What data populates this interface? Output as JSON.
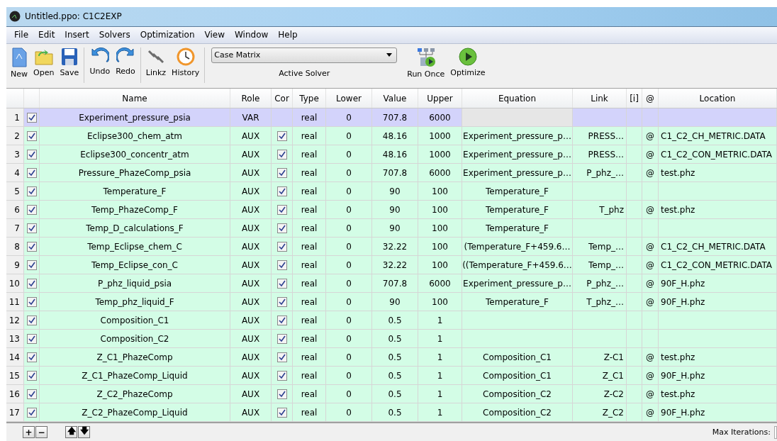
{
  "window": {
    "title": "Untitled.ppo: C1C2EXP"
  },
  "menu": [
    "File",
    "Edit",
    "Insert",
    "Solvers",
    "Optimization",
    "View",
    "Window",
    "Help"
  ],
  "toolbar": [
    {
      "kind": "new",
      "label": "New"
    },
    {
      "kind": "open",
      "label": "Open"
    },
    {
      "kind": "save",
      "label": "Save"
    },
    {
      "kind": "undo",
      "label": "Undo"
    },
    {
      "kind": "redo",
      "label": "Redo"
    },
    {
      "kind": "link",
      "label": "Linkz"
    },
    {
      "kind": "history",
      "label": "History"
    },
    {
      "kind": "solver",
      "value": "Case Matrix",
      "label": "Active Solver"
    },
    {
      "kind": "run",
      "label": "Run Once"
    },
    {
      "kind": "optimize",
      "label": "Optimize"
    }
  ],
  "table": {
    "columns": [
      "Name",
      "Role",
      "Cor",
      "Type",
      "Lower",
      "Value",
      "Upper",
      "Equation",
      "Link",
      "[i]",
      "@",
      "Location"
    ],
    "rows": [
      {
        "num": "1",
        "checked": true,
        "kind": "var",
        "name": "Experiment_pressure_psia",
        "role": "VAR",
        "cor_checked": false,
        "type": "real",
        "lower": "0",
        "value": "707.8",
        "upper": "6000"
      },
      {
        "num": "2",
        "checked": true,
        "kind": "aux",
        "name": "Eclipse300_chem_atm",
        "role": "AUX",
        "cor_checked": true,
        "type": "real",
        "lower": "0",
        "value": "48.16",
        "upper": "1000",
        "equation": "Experiment_pressure_p…",
        "link": "PRESS…",
        "at": "@",
        "location": "C1_C2_CH_METRIC.DATA"
      },
      {
        "num": "3",
        "checked": true,
        "kind": "aux",
        "name": "Eclipse300_concentr_atm",
        "role": "AUX",
        "cor_checked": true,
        "type": "real",
        "lower": "0",
        "value": "48.16",
        "upper": "1000",
        "equation": "Experiment_pressure_p…",
        "link": "PRESS…",
        "at": "@",
        "location": "C1_C2_CON_METRIC.DATA"
      },
      {
        "num": "4",
        "checked": true,
        "kind": "aux",
        "name": "Pressure_PhazeComp_psia",
        "role": "AUX",
        "cor_checked": true,
        "type": "real",
        "lower": "0",
        "value": "707.8",
        "upper": "6000",
        "equation": "Experiment_pressure_p…",
        "link": "P_phz_…",
        "at": "@",
        "location": "test.phz"
      },
      {
        "num": "5",
        "checked": true,
        "kind": "aux",
        "name": "Temperature_F",
        "role": "AUX",
        "cor_checked": true,
        "type": "real",
        "lower": "0",
        "value": "90",
        "upper": "100",
        "equation": "Temperature_F"
      },
      {
        "num": "6",
        "checked": true,
        "kind": "aux",
        "name": "Temp_PhazeComp_F",
        "role": "AUX",
        "cor_checked": true,
        "type": "real",
        "lower": "0",
        "value": "90",
        "upper": "100",
        "equation": "Temperature_F",
        "link": "T_phz",
        "at": "@",
        "location": "test.phz"
      },
      {
        "num": "7",
        "checked": true,
        "kind": "aux",
        "name": "Temp_D_calculations_F",
        "role": "AUX",
        "cor_checked": true,
        "type": "real",
        "lower": "0",
        "value": "90",
        "upper": "100",
        "equation": "Temperature_F"
      },
      {
        "num": "8",
        "checked": true,
        "kind": "aux",
        "name": "Temp_Eclipse_chem_C",
        "role": "AUX",
        "cor_checked": true,
        "type": "real",
        "lower": "0",
        "value": "32.22",
        "upper": "100",
        "equation": "(Temperature_F+459.6…",
        "link": "Temp_…",
        "at": "@",
        "location": "C1_C2_CH_METRIC.DATA"
      },
      {
        "num": "9",
        "checked": true,
        "kind": "aux",
        "name": "Temp_Eclipse_con_C",
        "role": "AUX",
        "cor_checked": true,
        "type": "real",
        "lower": "0",
        "value": "32.22",
        "upper": "100",
        "equation": "((Temperature_F+459.6…",
        "link": "Temp_…",
        "at": "@",
        "location": "C1_C2_CON_METRIC.DATA"
      },
      {
        "num": "10",
        "checked": true,
        "kind": "aux",
        "name": "P_phz_liquid_psia",
        "role": "AUX",
        "cor_checked": true,
        "type": "real",
        "lower": "0",
        "value": "707.8",
        "upper": "6000",
        "equation": "Experiment_pressure_p…",
        "link": "P_phz_…",
        "at": "@",
        "location": "90F_H.phz"
      },
      {
        "num": "11",
        "checked": true,
        "kind": "aux",
        "name": "Temp_phz_liquid_F",
        "role": "AUX",
        "cor_checked": true,
        "type": "real",
        "lower": "0",
        "value": "90",
        "upper": "100",
        "equation": "Temperature_F",
        "link": "T_phz_…",
        "at": "@",
        "location": "90F_H.phz"
      },
      {
        "num": "12",
        "checked": true,
        "kind": "aux",
        "name": "Composition_C1",
        "role": "AUX",
        "cor_checked": true,
        "type": "real",
        "lower": "0",
        "value": "0.5",
        "upper": "1"
      },
      {
        "num": "13",
        "checked": true,
        "kind": "aux",
        "name": "Composition_C2",
        "role": "AUX",
        "cor_checked": true,
        "type": "real",
        "lower": "0",
        "value": "0.5",
        "upper": "1"
      },
      {
        "num": "14",
        "checked": true,
        "kind": "aux",
        "name": "Z_C1_PhazeComp",
        "role": "AUX",
        "cor_checked": true,
        "type": "real",
        "lower": "0",
        "value": "0.5",
        "upper": "1",
        "equation": "Composition_C1",
        "link": "Z-C1",
        "at": "@",
        "location": "test.phz"
      },
      {
        "num": "15",
        "checked": true,
        "kind": "aux",
        "name": "Z_C1_PhazeComp_Liquid",
        "role": "AUX",
        "cor_checked": true,
        "type": "real",
        "lower": "0",
        "value": "0.5",
        "upper": "1",
        "equation": "Composition_C1",
        "link": "Z_C1",
        "at": "@",
        "location": "90F_H.phz"
      },
      {
        "num": "16",
        "checked": true,
        "kind": "aux",
        "name": "Z_C2_PhazeComp",
        "role": "AUX",
        "cor_checked": true,
        "type": "real",
        "lower": "0",
        "value": "0.5",
        "upper": "1",
        "equation": "Composition_C2",
        "link": "Z-C2",
        "at": "@",
        "location": "test.phz"
      },
      {
        "num": "17",
        "checked": true,
        "kind": "aux",
        "name": "Z_C2_PhazeComp_Liquid",
        "role": "AUX",
        "cor_checked": true,
        "type": "real",
        "lower": "0",
        "value": "0.5",
        "upper": "1",
        "equation": "Composition_C2",
        "link": "Z_C2",
        "at": "@",
        "location": "90F_H.phz"
      }
    ]
  },
  "footer": {
    "buttons": [
      {
        "kind": "add",
        "label": "+"
      },
      {
        "kind": "remove",
        "label": "−"
      },
      {
        "kind": "up",
        "label": "🡅"
      },
      {
        "kind": "down",
        "label": "🡇"
      }
    ],
    "max_iterations_label": "Max Iterations:"
  }
}
